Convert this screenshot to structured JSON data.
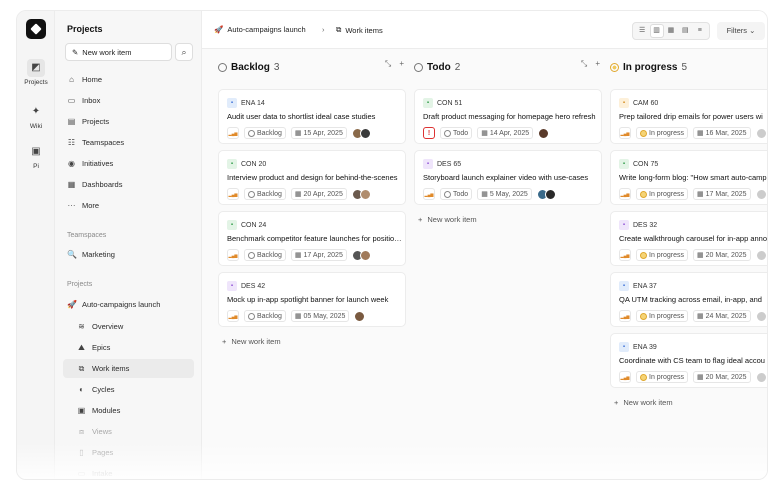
{
  "rail": [
    {
      "label": "Projects",
      "icon": "projects-icon",
      "active": true
    },
    {
      "label": "Wiki",
      "icon": "wiki-icon",
      "active": false
    },
    {
      "label": "Pi",
      "icon": "pi-icon",
      "active": false
    }
  ],
  "sidebar": {
    "title": "Projects",
    "new_item": "New work item",
    "nav": [
      {
        "label": "Home",
        "icon": "home-icon",
        "glyph": "⌂"
      },
      {
        "label": "Inbox",
        "icon": "inbox-icon",
        "glyph": "▭"
      },
      {
        "label": "Projects",
        "icon": "projects-icon",
        "glyph": "▤"
      },
      {
        "label": "Teamspaces",
        "icon": "teamspaces-icon",
        "glyph": "☷"
      },
      {
        "label": "Initiatives",
        "icon": "initiatives-icon",
        "glyph": "◉"
      },
      {
        "label": "Dashboards",
        "icon": "dashboards-icon",
        "glyph": "▦"
      },
      {
        "label": "More",
        "icon": "more-icon",
        "glyph": "···"
      }
    ],
    "teamspaces_label": "Teamspaces",
    "teamspace": {
      "label": "Marketing",
      "icon": "marketing-icon",
      "glyph": "🔍"
    },
    "projects_label": "Projects",
    "project": {
      "label": "Auto-campaigns launch",
      "icon": "rocket-icon",
      "glyph": "🚀"
    },
    "project_items": [
      {
        "label": "Overview",
        "icon": "overview-icon",
        "glyph": "≋",
        "active": false,
        "faded": false
      },
      {
        "label": "Epics",
        "icon": "epics-icon",
        "glyph": "⛰",
        "active": false,
        "faded": false
      },
      {
        "label": "Work items",
        "icon": "work-items-icon",
        "glyph": "⧉",
        "active": true,
        "faded": false
      },
      {
        "label": "Cycles",
        "icon": "cycles-icon",
        "glyph": "◐",
        "active": false,
        "faded": false
      },
      {
        "label": "Modules",
        "icon": "modules-icon",
        "glyph": "▣",
        "active": false,
        "faded": false
      },
      {
        "label": "Views",
        "icon": "views-icon",
        "glyph": "⧈",
        "active": false,
        "faded": true
      },
      {
        "label": "Pages",
        "icon": "pages-icon",
        "glyph": "▯",
        "active": false,
        "faded": true
      },
      {
        "label": "Intake",
        "icon": "intake-icon",
        "glyph": "▭",
        "active": false,
        "faded": true
      }
    ]
  },
  "topbar": {
    "project": "Auto-campaigns launch",
    "section": "Work items",
    "filters": "Filters"
  },
  "colors": {
    "in_progress": "#e0a82e",
    "urgent": "#d33333",
    "priority": "#e08a2a"
  },
  "columns": [
    {
      "name": "Backlog",
      "count": "3",
      "state": "backlog",
      "new_label": "New work item",
      "cards": [
        {
          "id": "ENA 14",
          "tag": "blue",
          "title": "Audit user data to shortlist ideal case studies",
          "status": "Backlog",
          "date": "15 Apr, 2025",
          "urgent": false,
          "avatars": [
            "#8a6a4a",
            "#3a3a3a"
          ]
        },
        {
          "id": "CON 20",
          "tag": "green",
          "title": "Interview product and design for behind-the-scenes",
          "status": "Backlog",
          "date": "20 Apr, 2025",
          "urgent": false,
          "avatars": [
            "#6b5a4e",
            "#b08d6e"
          ]
        },
        {
          "id": "CON 24",
          "tag": "green",
          "title": "Benchmark competitor feature launches for positioning",
          "status": "Backlog",
          "date": "17 Apr, 2025",
          "urgent": false,
          "avatars": [
            "#555555",
            "#a07a5a"
          ]
        },
        {
          "id": "DES 42",
          "tag": "purple",
          "title": "Mock up in-app spotlight banner for launch week",
          "status": "Backlog",
          "date": "05 May, 2025",
          "urgent": false,
          "avatars": [
            "#7a5a40"
          ]
        }
      ]
    },
    {
      "name": "Todo",
      "count": "2",
      "state": "todo",
      "new_label": "New work item",
      "cards": [
        {
          "id": "CON 51",
          "tag": "green",
          "title": "Draft product messaging for homepage hero refresh",
          "status": "Todo",
          "date": "14 Apr, 2025",
          "urgent": true,
          "avatars": [
            "#5a3a2a"
          ]
        },
        {
          "id": "DES 65",
          "tag": "purple",
          "title": "Storyboard launch explainer video with use-cases",
          "status": "Todo",
          "date": "5 May, 2025",
          "urgent": false,
          "avatars": [
            "#3a6a8a",
            "#2a2a2a"
          ]
        }
      ]
    },
    {
      "name": "In progress",
      "count": "5",
      "state": "progress",
      "new_label": "New work item",
      "cards": [
        {
          "id": "CAM 60",
          "tag": "orange",
          "title": "Prep tailored drip emails for power users wi",
          "status": "In progress",
          "date": "16 Mar, 2025",
          "urgent": false,
          "avatars": [
            "#cccccc"
          ]
        },
        {
          "id": "CON 75",
          "tag": "green",
          "title": "Write long-form blog: \"How smart auto-camp",
          "status": "In progress",
          "date": "17 Mar, 2025",
          "urgent": false,
          "avatars": [
            "#cccccc"
          ]
        },
        {
          "id": "DES 32",
          "tag": "purple",
          "title": "Create walkthrough carousel for in-app anno",
          "status": "In progress",
          "date": "20 Mar, 2025",
          "urgent": false,
          "avatars": [
            "#cccccc"
          ]
        },
        {
          "id": "ENA 37",
          "tag": "blue",
          "title": "QA UTM tracking across email, in-app, and",
          "status": "In progress",
          "date": "24 Mar, 2025",
          "urgent": false,
          "avatars": [
            "#cccccc"
          ]
        },
        {
          "id": "ENA 39",
          "tag": "blue",
          "title": "Coordinate with CS team to flag ideal accou",
          "status": "In progress",
          "date": "20 Mar, 2025",
          "urgent": false,
          "avatars": [
            "#cccccc"
          ]
        }
      ]
    }
  ]
}
